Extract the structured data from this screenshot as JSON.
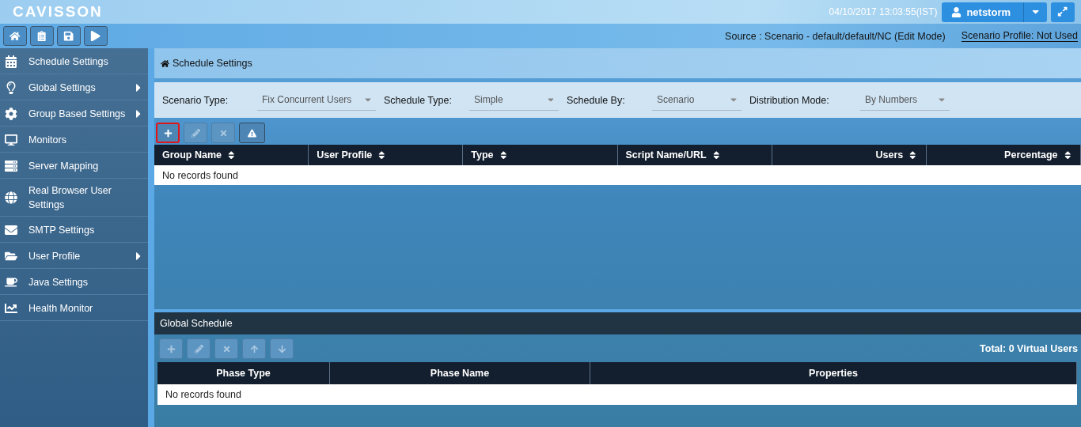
{
  "header": {
    "logo": "CAVISSON",
    "datetime": "04/10/2017 13:03:55(IST)",
    "user_button": "netstorm"
  },
  "toolbar": {
    "buttons": [
      {
        "kind": "home"
      },
      {
        "kind": "schedule"
      },
      {
        "kind": "save"
      },
      {
        "kind": "play"
      }
    ],
    "source": "Source : Scenario - default/default/NC (Edit Mode)",
    "profile_link": "Scenario Profile: Not Used"
  },
  "sidebar": {
    "items": [
      {
        "label": "Schedule Settings",
        "submenu": false
      },
      {
        "label": "Global Settings",
        "submenu": true
      },
      {
        "label": "Group Based Settings",
        "submenu": true
      },
      {
        "label": "Monitors",
        "submenu": false
      },
      {
        "label": "Server Mapping",
        "submenu": false
      },
      {
        "label": "Real Browser User Settings",
        "submenu": false
      },
      {
        "label": "SMTP Settings",
        "submenu": false
      },
      {
        "label": "User Profile",
        "submenu": true
      },
      {
        "label": "Java Settings",
        "submenu": false
      },
      {
        "label": "Health Monitor",
        "submenu": false
      }
    ]
  },
  "breadcrumb": "Schedule Settings",
  "filters": [
    {
      "label": "Scenario Type:",
      "value": "Fix Concurrent Users"
    },
    {
      "label": "Schedule Type:",
      "value": "Simple"
    },
    {
      "label": "Schedule By:",
      "value": "Scenario"
    },
    {
      "label": "Distribution Mode:",
      "value": "By Numbers"
    }
  ],
  "group_table": {
    "buttons": [
      {
        "kind": "add",
        "disabled": false,
        "highlighted": true
      },
      {
        "kind": "edit",
        "disabled": true,
        "highlighted": false
      },
      {
        "kind": "delete",
        "disabled": true,
        "highlighted": false
      },
      {
        "kind": "warning",
        "disabled": false,
        "highlighted": false
      }
    ],
    "columns": [
      {
        "label": "Group Name",
        "right_aligned": false
      },
      {
        "label": "User Profile",
        "right_aligned": false
      },
      {
        "label": "Type",
        "right_aligned": false
      },
      {
        "label": "Script Name/URL",
        "right_aligned": false
      },
      {
        "label": "Users",
        "right_aligned": true
      },
      {
        "label": "Percentage",
        "right_aligned": true
      }
    ],
    "empty_message": "No records found"
  },
  "global_schedule": {
    "title": "Global Schedule",
    "buttons": [
      {
        "kind": "add",
        "disabled": true
      },
      {
        "kind": "edit",
        "disabled": true
      },
      {
        "kind": "delete",
        "disabled": true
      },
      {
        "kind": "up",
        "disabled": true
      },
      {
        "kind": "down",
        "disabled": true
      }
    ],
    "total": "Total: 0 Virtual Users",
    "columns": [
      "Phase Type",
      "Phase Name",
      "Properties"
    ],
    "empty_message": "No records found"
  }
}
